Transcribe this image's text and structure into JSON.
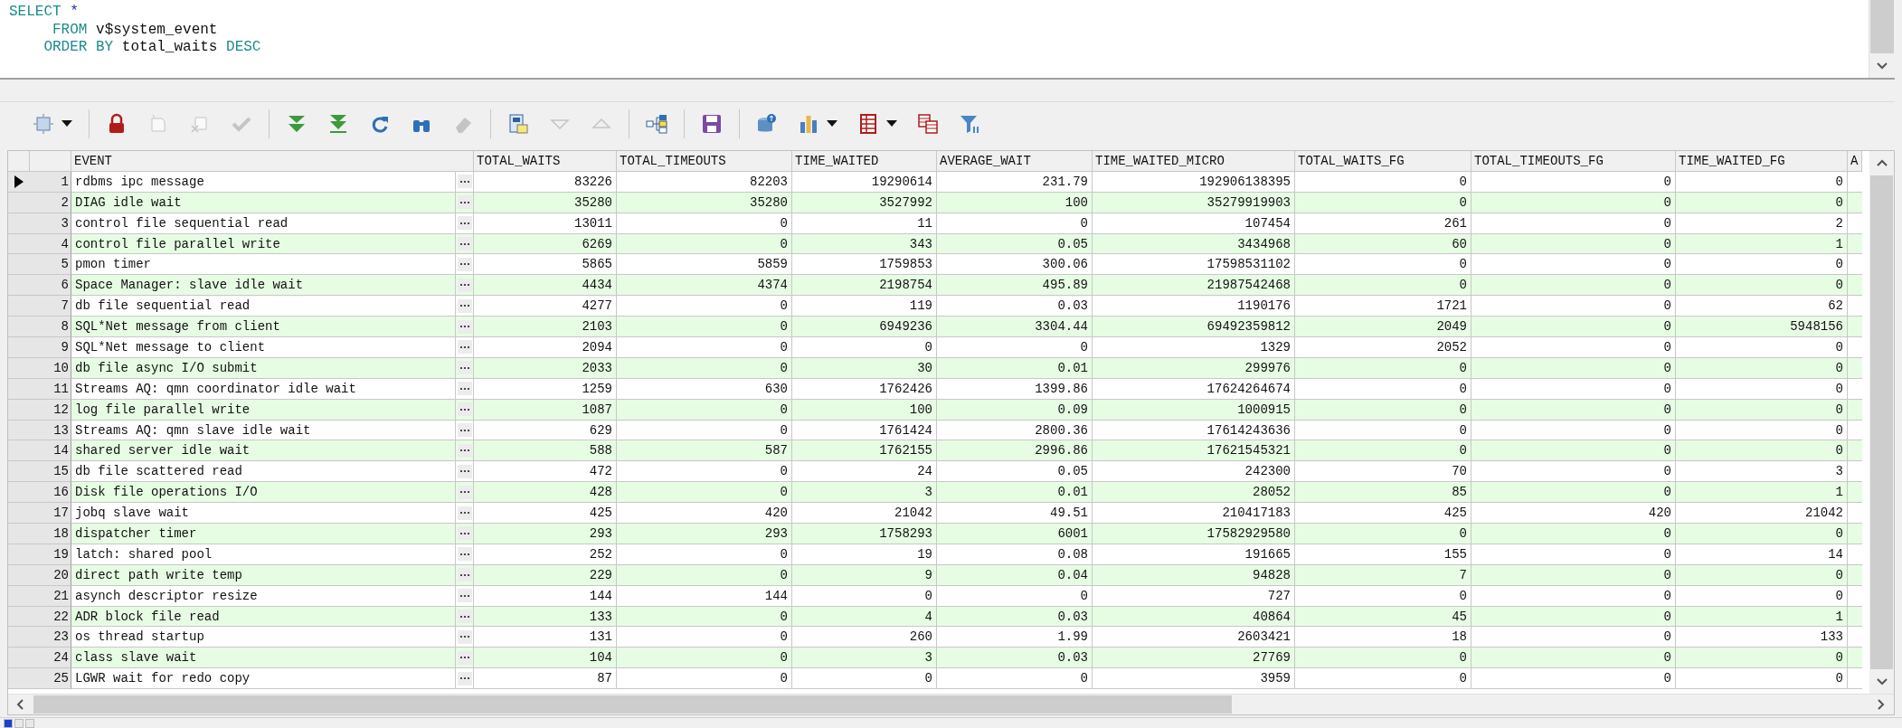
{
  "editor": {
    "lines": [
      [
        {
          "text": "SELECT",
          "kind": "keyword"
        },
        {
          "text": " *",
          "kind": "operator"
        }
      ],
      [
        {
          "text": "     FROM",
          "kind": "keyword"
        },
        {
          "text": " v$system_event",
          "kind": "identifier"
        }
      ],
      [
        {
          "text": "    ORDER BY",
          "kind": "keyword"
        },
        {
          "text": " total_waits ",
          "kind": "identifier"
        },
        {
          "text": "DESC",
          "kind": "keyword"
        }
      ]
    ]
  },
  "toolbar": {
    "groups": [
      [
        {
          "disabled": false
        }
      ],
      [
        {
          "disabled": false
        },
        {
          "disabled": true
        },
        {
          "disabled": true
        },
        {
          "disabled": true
        }
      ],
      [
        {
          "disabled": false
        },
        {
          "disabled": false
        },
        {
          "disabled": false
        },
        {
          "disabled": false
        },
        {
          "disabled": true
        }
      ],
      [
        {
          "disabled": false
        },
        {
          "disabled": true
        },
        {
          "disabled": true
        }
      ],
      [
        {
          "disabled": false
        }
      ],
      [
        {
          "disabled": false
        }
      ],
      [
        {
          "disabled": false
        },
        {
          "disabled": false
        },
        {
          "disabled": false
        },
        {
          "disabled": false
        },
        {
          "disabled": false
        }
      ]
    ]
  },
  "table": {
    "columns": [
      "EVENT",
      "TOTAL_WAITS",
      "TOTAL_TIMEOUTS",
      "TIME_WAITED",
      "AVERAGE_WAIT",
      "TIME_WAITED_MICRO",
      "TOTAL_WAITS_FG",
      "TOTAL_TIMEOUTS_FG",
      "TIME_WAITED_FG",
      "A"
    ],
    "rows": [
      {
        "number": "1",
        "selected": true,
        "cells": [
          "rdbms ipc message",
          "83226",
          "82203",
          "19290614",
          "231.79",
          "192906138395",
          "0",
          "0",
          "0"
        ]
      },
      {
        "number": "2",
        "selected": false,
        "cells": [
          "DIAG idle wait",
          "35280",
          "35280",
          "3527992",
          "100",
          "35279919903",
          "0",
          "0",
          "0"
        ]
      },
      {
        "number": "3",
        "selected": false,
        "cells": [
          "control file sequential read",
          "13011",
          "0",
          "11",
          "0",
          "107454",
          "261",
          "0",
          "2"
        ]
      },
      {
        "number": "4",
        "selected": false,
        "cells": [
          "control file parallel write",
          "6269",
          "0",
          "343",
          "0.05",
          "3434968",
          "60",
          "0",
          "1"
        ]
      },
      {
        "number": "5",
        "selected": false,
        "cells": [
          "pmon timer",
          "5865",
          "5859",
          "1759853",
          "300.06",
          "17598531102",
          "0",
          "0",
          "0"
        ]
      },
      {
        "number": "6",
        "selected": false,
        "cells": [
          "Space Manager: slave idle wait",
          "4434",
          "4374",
          "2198754",
          "495.89",
          "21987542468",
          "0",
          "0",
          "0"
        ]
      },
      {
        "number": "7",
        "selected": false,
        "cells": [
          "db file sequential read",
          "4277",
          "0",
          "119",
          "0.03",
          "1190176",
          "1721",
          "0",
          "62"
        ]
      },
      {
        "number": "8",
        "selected": false,
        "cells": [
          "SQL*Net message from client",
          "2103",
          "0",
          "6949236",
          "3304.44",
          "69492359812",
          "2049",
          "0",
          "5948156"
        ]
      },
      {
        "number": "9",
        "selected": false,
        "cells": [
          "SQL*Net message to client",
          "2094",
          "0",
          "0",
          "0",
          "1329",
          "2052",
          "0",
          "0"
        ]
      },
      {
        "number": "10",
        "selected": false,
        "cells": [
          "db file async I/O submit",
          "2033",
          "0",
          "30",
          "0.01",
          "299976",
          "0",
          "0",
          "0"
        ]
      },
      {
        "number": "11",
        "selected": false,
        "cells": [
          "Streams AQ: qmn coordinator idle wait",
          "1259",
          "630",
          "1762426",
          "1399.86",
          "17624264674",
          "0",
          "0",
          "0"
        ]
      },
      {
        "number": "12",
        "selected": false,
        "cells": [
          "log file parallel write",
          "1087",
          "0",
          "100",
          "0.09",
          "1000915",
          "0",
          "0",
          "0"
        ]
      },
      {
        "number": "13",
        "selected": false,
        "cells": [
          "Streams AQ: qmn slave idle wait",
          "629",
          "0",
          "1761424",
          "2800.36",
          "17614243636",
          "0",
          "0",
          "0"
        ]
      },
      {
        "number": "14",
        "selected": false,
        "cells": [
          "shared server idle wait",
          "588",
          "587",
          "1762155",
          "2996.86",
          "17621545321",
          "0",
          "0",
          "0"
        ]
      },
      {
        "number": "15",
        "selected": false,
        "cells": [
          "db file scattered read",
          "472",
          "0",
          "24",
          "0.05",
          "242300",
          "70",
          "0",
          "3"
        ]
      },
      {
        "number": "16",
        "selected": false,
        "cells": [
          "Disk file operations I/O",
          "428",
          "0",
          "3",
          "0.01",
          "28052",
          "85",
          "0",
          "1"
        ]
      },
      {
        "number": "17",
        "selected": false,
        "cells": [
          "jobq slave wait",
          "425",
          "420",
          "21042",
          "49.51",
          "210417183",
          "425",
          "420",
          "21042"
        ]
      },
      {
        "number": "18",
        "selected": false,
        "cells": [
          "dispatcher timer",
          "293",
          "293",
          "1758293",
          "6001",
          "17582929580",
          "0",
          "0",
          "0"
        ]
      },
      {
        "number": "19",
        "selected": false,
        "cells": [
          "latch: shared pool",
          "252",
          "0",
          "19",
          "0.08",
          "191665",
          "155",
          "0",
          "14"
        ]
      },
      {
        "number": "20",
        "selected": false,
        "cells": [
          "direct path write temp",
          "229",
          "0",
          "9",
          "0.04",
          "94828",
          "7",
          "0",
          "0"
        ]
      },
      {
        "number": "21",
        "selected": false,
        "cells": [
          "asynch descriptor resize",
          "144",
          "144",
          "0",
          "0",
          "727",
          "0",
          "0",
          "0"
        ]
      },
      {
        "number": "22",
        "selected": false,
        "cells": [
          "ADR block file read",
          "133",
          "0",
          "4",
          "0.03",
          "40864",
          "45",
          "0",
          "1"
        ]
      },
      {
        "number": "23",
        "selected": false,
        "cells": [
          "os thread startup",
          "131",
          "0",
          "260",
          "1.99",
          "2603421",
          "18",
          "0",
          "133"
        ]
      },
      {
        "number": "24",
        "selected": false,
        "cells": [
          "class slave wait",
          "104",
          "0",
          "3",
          "0.03",
          "27769",
          "0",
          "0",
          "0"
        ]
      },
      {
        "number": "25",
        "selected": false,
        "cells": [
          "LGWR wait for redo copy",
          "87",
          "0",
          "0",
          "0",
          "3959",
          "0",
          "0",
          "0"
        ]
      }
    ]
  }
}
